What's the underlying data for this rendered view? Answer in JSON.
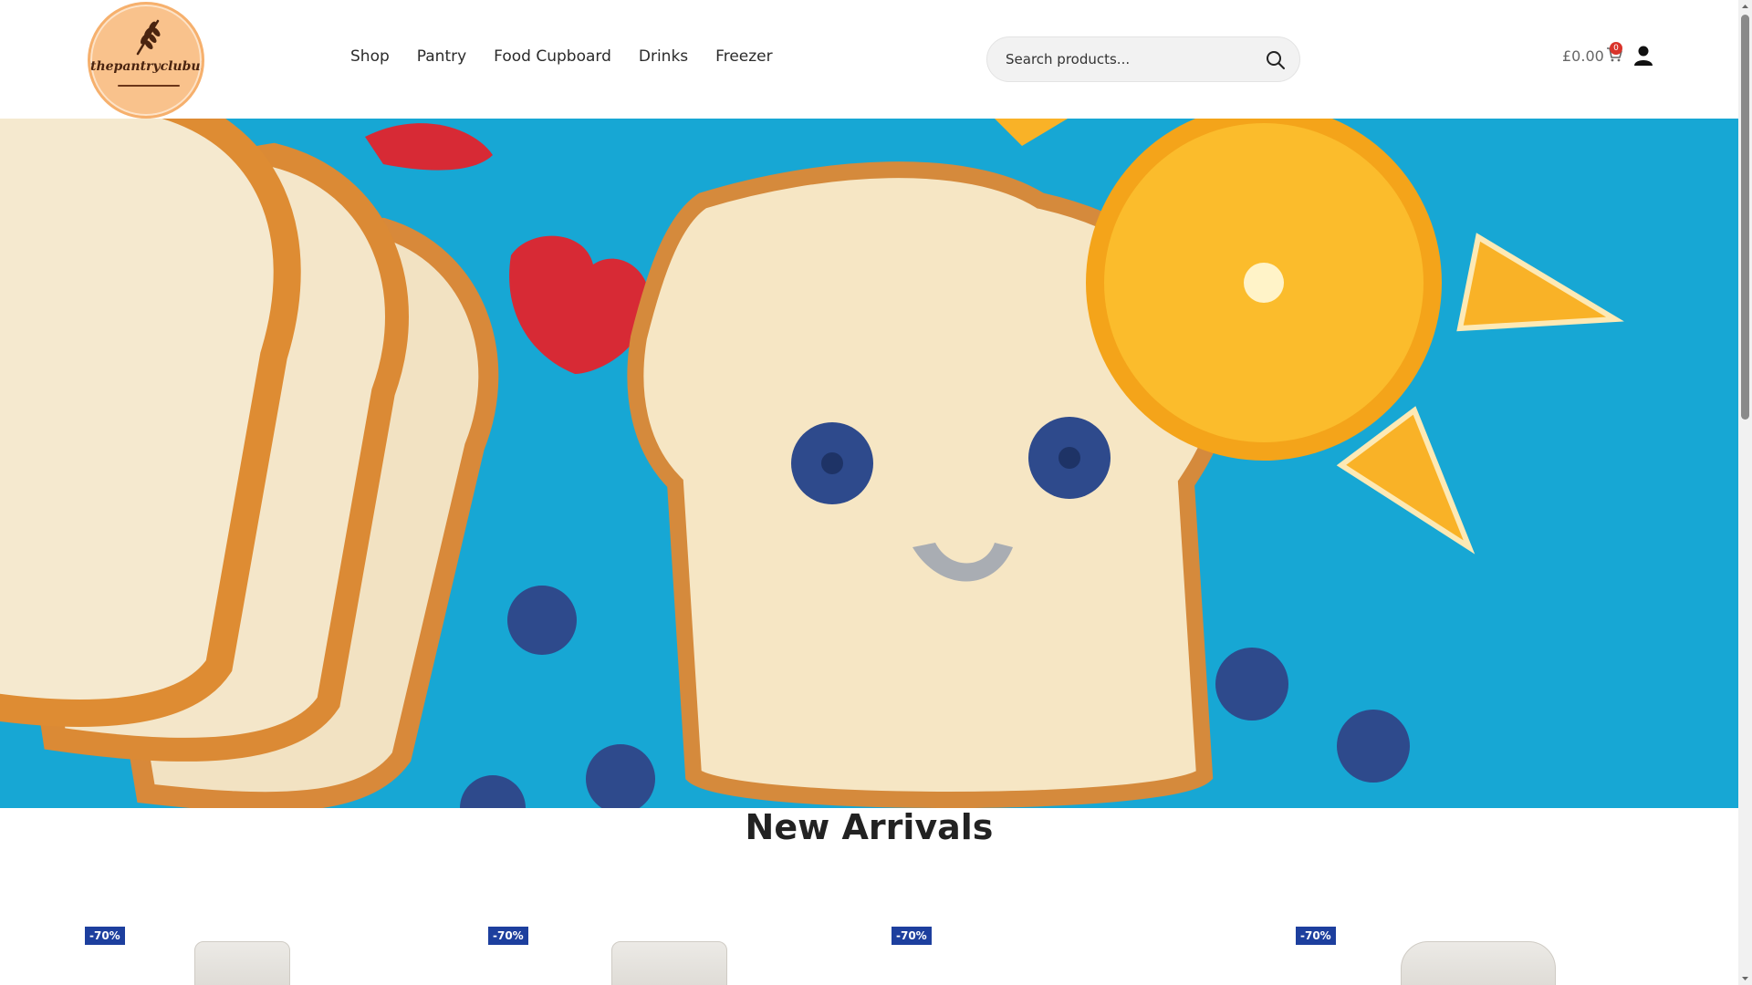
{
  "header": {
    "logo_text": "thepantryclubuk",
    "nav": [
      {
        "label": "Shop"
      },
      {
        "label": "Pantry"
      },
      {
        "label": "Food Cupboard"
      },
      {
        "label": "Drinks"
      },
      {
        "label": "Freezer"
      }
    ],
    "search": {
      "placeholder": "Search products..."
    },
    "cart": {
      "amount": "£0.00",
      "count": "0"
    },
    "icons": {
      "search": "search-icon",
      "cart": "cart-icon",
      "account": "user-icon"
    }
  },
  "hero": {
    "image": "bread slice with blueberry smiley face on blue background"
  },
  "new_arrivals": {
    "title": "New Arrivals",
    "products": [
      {
        "badge": "-70%"
      },
      {
        "badge": "-70%"
      },
      {
        "badge": "-70%"
      },
      {
        "badge": "-70%"
      }
    ]
  },
  "colors": {
    "logo_bg": "#f9c28c",
    "hero_bg": "#17a7d4",
    "badge_bg": "#1d3f9e",
    "cart_badge": "#d9342b"
  }
}
